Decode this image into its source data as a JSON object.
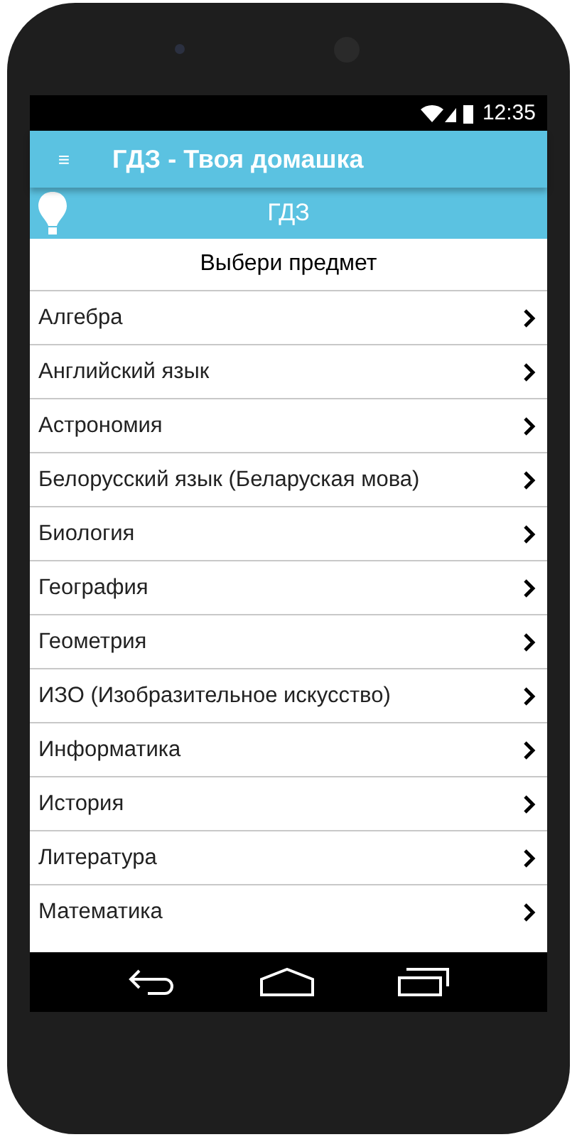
{
  "status_bar": {
    "time": "12:35"
  },
  "app_bar": {
    "menu_icon": "≡",
    "title": "ГДЗ - Твоя домашка"
  },
  "section_bar": {
    "title": "ГДЗ"
  },
  "list": {
    "heading": "Выбери предмет",
    "items": [
      {
        "label": "Алгебра"
      },
      {
        "label": "Английский язык"
      },
      {
        "label": "Астрономия"
      },
      {
        "label": "Белорусский язык (Беларуская мова)"
      },
      {
        "label": "Биология"
      },
      {
        "label": "География"
      },
      {
        "label": "Геометрия"
      },
      {
        "label": "ИЗО (Изобразительное искусство)"
      },
      {
        "label": "Информатика"
      },
      {
        "label": "История"
      },
      {
        "label": "Литература"
      },
      {
        "label": "Математика"
      }
    ]
  }
}
